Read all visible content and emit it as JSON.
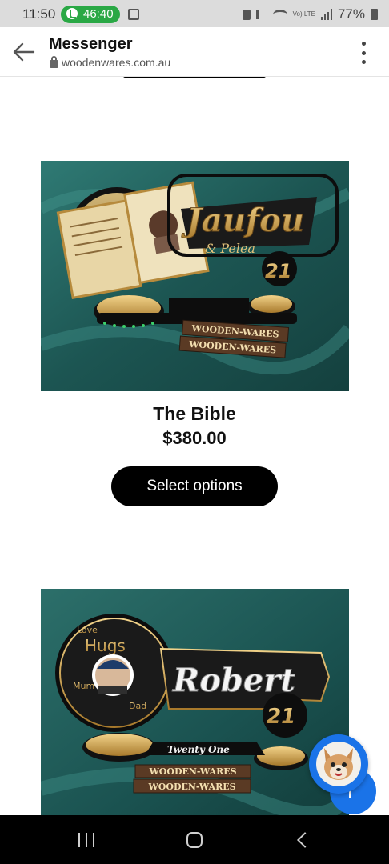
{
  "status_bar": {
    "time": "11:50",
    "call_duration": "46:40",
    "battery": "77%",
    "network": "Vo) LTE"
  },
  "app_bar": {
    "title": "Messenger",
    "url": "woodenwares.com.au"
  },
  "products": [
    {
      "title": "The Bible",
      "price": "$380.00",
      "button": "Select options",
      "image_text": [
        "Jaufou",
        "& Pelea",
        "21",
        "WOODEN-WARES",
        "WOODEN-WARES"
      ]
    },
    {
      "title": "",
      "price": "",
      "button": "",
      "image_text": [
        "Robert",
        "21",
        "Twenty One",
        "Hugs",
        "Love",
        "Mum",
        "Dad",
        "WOODEN-WARES",
        "WOODEN-WARES"
      ]
    }
  ],
  "colors": {
    "button_bg": "#000000",
    "button_text": "#ffffff",
    "fab": "#1a73e8",
    "call_pill": "#2aa845",
    "velvet": "#1f5f5c",
    "gold": "#c9a24a"
  },
  "icons": {
    "back": "arrow-left-icon",
    "menu": "more-vertical-icon",
    "lock": "lock-icon",
    "chat": "dog-avatar-icon",
    "scroll_top": "arrow-up-icon"
  }
}
